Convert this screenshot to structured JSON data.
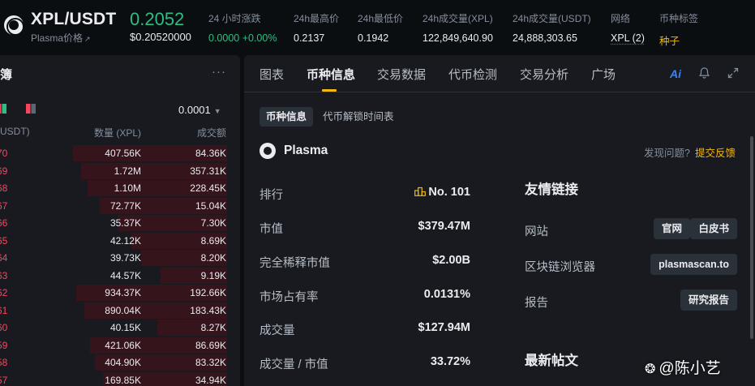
{
  "header": {
    "symbol": "XPL/USDT",
    "subtitle": "Plasma价格",
    "last_price": "0.2052",
    "last_price_usd": "$0.20520000",
    "stats": [
      {
        "label": "24 小时涨跌",
        "value": "0.0000 +0.00%"
      },
      {
        "label": "24h最高价",
        "value": "0.2137"
      },
      {
        "label": "24h最低价",
        "value": "0.1942"
      },
      {
        "label": "24h成交量(XPL)",
        "value": "122,849,640.90"
      },
      {
        "label": "24h成交量(USDT)",
        "value": "24,888,303.65"
      },
      {
        "label": "网络",
        "value": "XPL (2)"
      },
      {
        "label": "币种标签",
        "value": "种子"
      }
    ]
  },
  "orderbook": {
    "title": "簿",
    "more": "···",
    "precision": "0.0001",
    "headers": {
      "price": "(USDT)",
      "qty": "数量 (XPL)",
      "total": "成交额"
    },
    "rows": [
      {
        "price": "70",
        "qty": "407.56K",
        "total": "84.36K",
        "depth": 0.97
      },
      {
        "price": "69",
        "qty": "1.72M",
        "total": "357.31K",
        "depth": 0.92
      },
      {
        "price": "68",
        "qty": "1.10M",
        "total": "228.45K",
        "depth": 0.88
      },
      {
        "price": "67",
        "qty": "72.77K",
        "total": "15.04K",
        "depth": 0.8
      },
      {
        "price": "66",
        "qty": "35.37K",
        "total": "7.30K",
        "depth": 0.69
      },
      {
        "price": "65",
        "qty": "42.12K",
        "total": "8.69K",
        "depth": 0.6
      },
      {
        "price": "64",
        "qty": "39.73K",
        "total": "8.20K",
        "depth": 0.54
      },
      {
        "price": "63",
        "qty": "44.57K",
        "total": "9.19K",
        "depth": 0.42
      },
      {
        "price": "62",
        "qty": "934.37K",
        "total": "192.66K",
        "depth": 0.95
      },
      {
        "price": "61",
        "qty": "890.04K",
        "total": "183.43K",
        "depth": 0.9
      },
      {
        "price": "60",
        "qty": "40.15K",
        "total": "8.27K",
        "depth": 0.44
      },
      {
        "price": "59",
        "qty": "421.06K",
        "total": "86.69K",
        "depth": 0.86
      },
      {
        "price": "58",
        "qty": "404.90K",
        "total": "83.32K",
        "depth": 0.83
      },
      {
        "price": "57",
        "qty": "169.85K",
        "total": "34.94K",
        "depth": 0.78
      }
    ]
  },
  "tabs": [
    "图表",
    "币种信息",
    "交易数据",
    "代币检测",
    "交易分析",
    "广场"
  ],
  "tab_icons": {
    "ai": "Ai"
  },
  "subtabs": [
    "币种信息",
    "代币解锁时间表"
  ],
  "coin": {
    "name": "Plasma",
    "issue_text": "发现问题?",
    "issue_link": "提交反馈"
  },
  "metrics": [
    {
      "label": "排行",
      "value": "No. 101"
    },
    {
      "label": "市值",
      "value": "$379.47M"
    },
    {
      "label": "完全稀释市值",
      "value": "$2.00B"
    },
    {
      "label": "市场占有率",
      "value": "0.0131%"
    },
    {
      "label": "成交量",
      "value": "$127.94M"
    },
    {
      "label": "成交量 / 市值",
      "value": "33.72%"
    }
  ],
  "links": {
    "title": "友情链接",
    "website_label": "网站",
    "official": "官网",
    "whitepaper": "白皮书",
    "explorer_label": "区块链浏览器",
    "explorer": "plasmascan.to",
    "report_label": "报告",
    "report": "研究报告"
  },
  "news_title": "最新帖文",
  "watermark": "@陈小艺",
  "colors": {
    "green": "#2ebd85",
    "red": "#f6465d",
    "yellow": "#f0b90b",
    "bg": "#0b0e11",
    "panel": "#181a20"
  }
}
